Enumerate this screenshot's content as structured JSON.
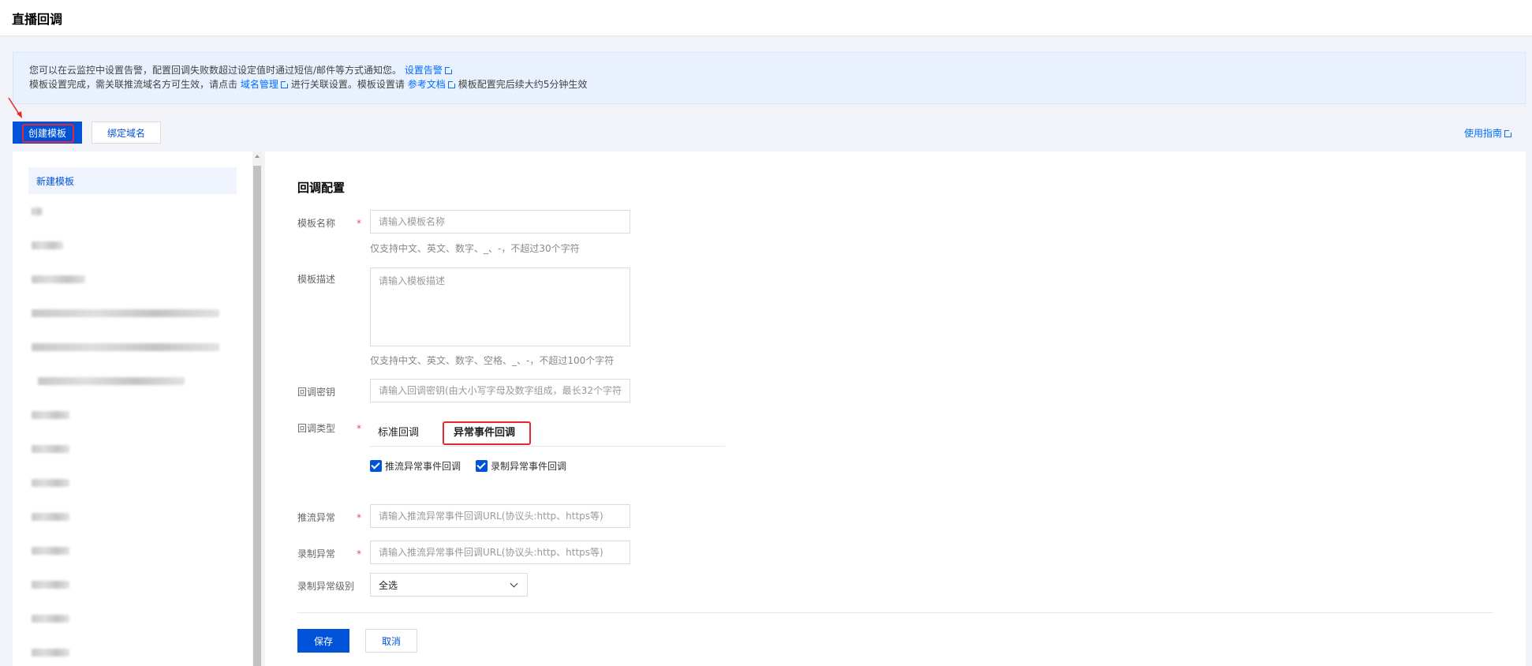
{
  "page": {
    "title": "直播回调"
  },
  "notice": {
    "line1_text": "您可以在云监控中设置告警，配置回调失败数超过设定值时通过短信/邮件等方式通知您。",
    "line1_link": "设置告警",
    "line2_part1": "模板设置完成，需关联推流域名方可生效，请点击",
    "line2_link1": "域名管理",
    "line2_part2": "进行关联设置。模板设置请",
    "line2_link2": "参考文档",
    "line2_part3": "模板配置完后续大约5分钟生效"
  },
  "toolbar": {
    "create_label": "创建模板",
    "bind_label": "绑定域名",
    "guide_label": "使用指南"
  },
  "sidebar": {
    "active_item": "新建模板"
  },
  "form": {
    "section_title": "回调配置",
    "name": {
      "label": "模板名称",
      "placeholder": "请输入模板名称",
      "hint": "仅支持中文、英文、数字、_、-，不超过30个字符"
    },
    "desc": {
      "label": "模板描述",
      "placeholder": "请输入模板描述",
      "hint": "仅支持中文、英文、数字、空格、_、-，不超过100个字符"
    },
    "key": {
      "label": "回调密钥",
      "placeholder": "请输入回调密钥(由大小写字母及数字组成，最长32个字符)"
    },
    "type": {
      "label": "回调类型",
      "tab1": "标准回调",
      "tab2": "异常事件回调",
      "checkbox1": "推流异常事件回调",
      "checkbox2": "录制异常事件回调"
    },
    "push_error": {
      "label": "推流异常",
      "placeholder": "请输入推流异常事件回调URL(协议头:http、https等)"
    },
    "record_error": {
      "label": "录制异常",
      "placeholder": "请输入推流异常事件回调URL(协议头:http、https等)"
    },
    "record_level": {
      "label": "录制异常级别",
      "value": "全选"
    },
    "required_mark": "*",
    "save_label": "保存",
    "cancel_label": "取消"
  },
  "colors": {
    "primary": "#0052d9",
    "link": "#006eff",
    "highlight": "#e8262c",
    "notice_bg": "#e9f0fe"
  }
}
